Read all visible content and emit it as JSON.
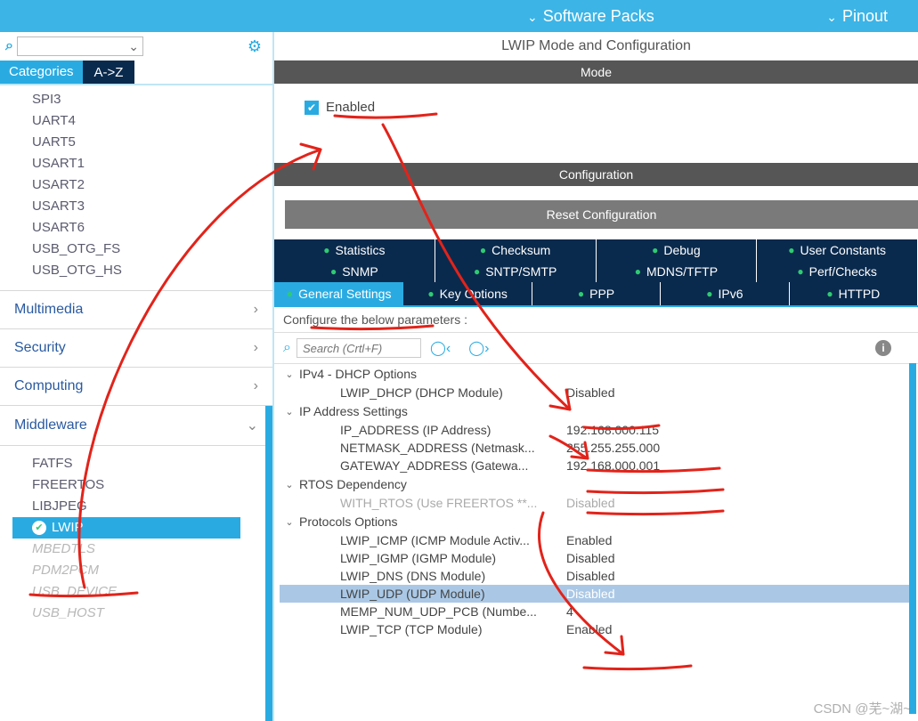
{
  "topbar": {
    "software_packs": "Software Packs",
    "pinout": "Pinout"
  },
  "left": {
    "search_placeholder": "",
    "tab_categories": "Categories",
    "tab_az": "A->Z",
    "peripherals": [
      "SPI3",
      "UART4",
      "UART5",
      "USART1",
      "USART2",
      "USART3",
      "USART6",
      "USB_OTG_FS",
      "USB_OTG_HS"
    ],
    "cats": {
      "multimedia": "Multimedia",
      "security": "Security",
      "computing": "Computing",
      "middleware": "Middleware"
    },
    "middleware_items": {
      "fatfs": "FATFS",
      "freertos": "FREERTOS",
      "libjpeg": "LIBJPEG",
      "lwip": "LWIP",
      "mbedtls": "MBEDTLS",
      "pdm2pcm": "PDM2PCM",
      "usb_device": "USB_DEVICE",
      "usb_host": "USB_HOST"
    }
  },
  "right": {
    "title": "LWIP Mode and Configuration",
    "mode_label": "Mode",
    "enabled_label": "Enabled",
    "config_label": "Configuration",
    "reset_label": "Reset Configuration",
    "tabs_row1": [
      "Statistics",
      "Checksum",
      "Debug",
      "User Constants"
    ],
    "tabs_row2": [
      "SNMP",
      "SNTP/SMTP",
      "MDNS/TFTP",
      "Perf/Checks"
    ],
    "tabs_row3": [
      "General Settings",
      "Key Options",
      "PPP",
      "IPv6",
      "HTTPD"
    ],
    "params_head": "Configure the below parameters :",
    "search_placeholder": "Search (Crtl+F)",
    "groups": {
      "g0": {
        "name": "IPv4 - DHCP Options",
        "rows": [
          {
            "label": "LWIP_DHCP (DHCP Module)",
            "value": "Disabled"
          }
        ]
      },
      "g1": {
        "name": "IP Address Settings",
        "rows": [
          {
            "label": "IP_ADDRESS (IP Address)",
            "value": "192.168.000.115"
          },
          {
            "label": "NETMASK_ADDRESS (Netmask...",
            "value": "255.255.255.000"
          },
          {
            "label": "GATEWAY_ADDRESS (Gatewa...",
            "value": "192.168.000.001"
          }
        ]
      },
      "g2": {
        "name": "RTOS Dependency",
        "rows": [
          {
            "label": "WITH_RTOS (Use FREERTOS **...",
            "value": "Disabled",
            "disabled": true
          }
        ]
      },
      "g3": {
        "name": "Protocols Options",
        "rows": [
          {
            "label": "LWIP_ICMP (ICMP Module Activ...",
            "value": "Enabled"
          },
          {
            "label": "LWIP_IGMP (IGMP Module)",
            "value": "Disabled"
          },
          {
            "label": "LWIP_DNS (DNS Module)",
            "value": "Disabled"
          },
          {
            "label": "LWIP_UDP (UDP Module)",
            "value": "Disabled",
            "selected": true
          },
          {
            "label": "MEMP_NUM_UDP_PCB (Numbe...",
            "value": "4"
          },
          {
            "label": "LWIP_TCP (TCP Module)",
            "value": "Enabled"
          }
        ]
      }
    }
  },
  "watermark": "CSDN @芜~湖~"
}
